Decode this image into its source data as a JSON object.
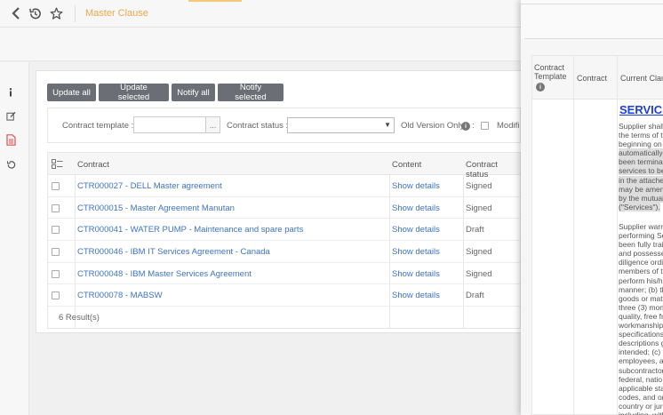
{
  "header": {
    "title": "Master Clause"
  },
  "toolbar": {
    "update_all": "Update all",
    "update_selected": "Update selected",
    "notify_all": "Notify all",
    "notify_selected": "Notify selected"
  },
  "filters": {
    "contract_template_label": "Contract template :",
    "contract_template_value": "",
    "browse_label": "...",
    "contract_status_label": "Contract status :",
    "contract_status_value": "",
    "old_version_label": "Old Version Only",
    "old_version_suffix": ":",
    "modified_label": "Modifi"
  },
  "table": {
    "columns": [
      "Contract",
      "Content",
      "Contract status"
    ],
    "rows": [
      {
        "contract": "CTR000027 - DELL Master agreement",
        "content": "Show details",
        "status": "Signed"
      },
      {
        "contract": "CTR000015 - Master Agreement Manutan",
        "content": "Show details",
        "status": "Signed"
      },
      {
        "contract": "CTR000041 - WATER PUMP - Maintenance and spare parts",
        "content": "Show details",
        "status": "Draft"
      },
      {
        "contract": "CTR000046 - IBM IT Services Agreement - Canada",
        "content": "Show details",
        "status": "Signed"
      },
      {
        "contract": "CTR000048 - IBM Master Services Agreement",
        "content": "Show details",
        "status": "Signed"
      },
      {
        "contract": "CTR000078 - MABSW",
        "content": "Show details",
        "status": "Draft"
      }
    ],
    "footer": "6 Result(s)"
  },
  "side_panel": {
    "columns": [
      "Contract Template",
      "Contract",
      "Current Clau"
    ],
    "clause_title": "SERVICE",
    "clause_p1_a": "Supplier shall\nthe terms of t\nbeginning on",
    "clause_p1_hl": "automatically\nbeen terminat\nservices to be\nin the attache\nmay be amen\nby the mutual\n(\"Services\").",
    "clause_p2": "Supplier warra\nperforming Se\nbeen fully trai\nand possesse\ndiligence ordi\nmembers of t\nperform his/h\nmanner; (b) th\ngoods or mate\nthree (3) mon\nquality, free fr\nworkmanship\nspecifications\ndescriptions g\nintended; (c) t\nemployees, a\nsubcontractor\nfederal, natio\napplicable sta\ncodes, and or\ncountry or juri\nincluding, with\nand Privacy L"
  },
  "colors": {
    "accent": "#e8a84c",
    "link": "#3d74c4",
    "button": "#6b6e75",
    "active_icon": "#d9534f",
    "clause_title": "#1f3fd6"
  },
  "icons": {
    "back": "chevron-left-icon",
    "history": "history-icon",
    "favorite": "star-icon",
    "info": "info-icon",
    "edit": "edit-icon",
    "document": "document-icon",
    "undo": "undo-icon",
    "columns": "columns-icon"
  }
}
